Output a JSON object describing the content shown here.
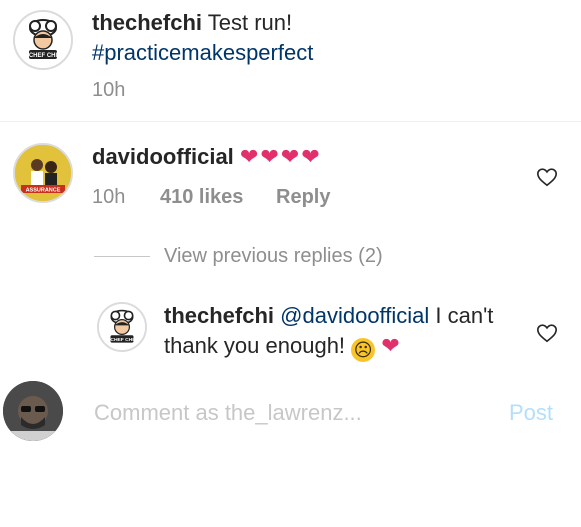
{
  "post": {
    "username": "thechefchi",
    "caption": "Test run!",
    "hashtag": "#practicemakesperfect",
    "time": "10h"
  },
  "comments": [
    {
      "username": "davidoofficial",
      "text": "❤❤❤❤",
      "time": "10h",
      "likes": "410 likes",
      "reply_label": "Reply"
    }
  ],
  "replies": {
    "view_previous": "View previous replies (2)",
    "items": [
      {
        "username": "thechefchi",
        "mention": "@davidoofficial",
        "text_line1_rest": " I can't",
        "text_line2": "thank you enough!",
        "emoji_frown": "☹",
        "emoji_heart": "❤"
      }
    ]
  },
  "composer": {
    "placeholder": "Comment as the_lawrenz...",
    "post_label": "Post"
  },
  "colors": {
    "text": "#262626",
    "secondary": "#8e8e8e",
    "link": "#003569",
    "heart": "#e1306c",
    "post_button": "#b2dffc"
  },
  "icons": {
    "heart_outline": "heart-outline-icon",
    "avatar_chef": "chef-logo-avatar",
    "avatar_davido": "davido-avatar",
    "avatar_user": "user-avatar"
  }
}
